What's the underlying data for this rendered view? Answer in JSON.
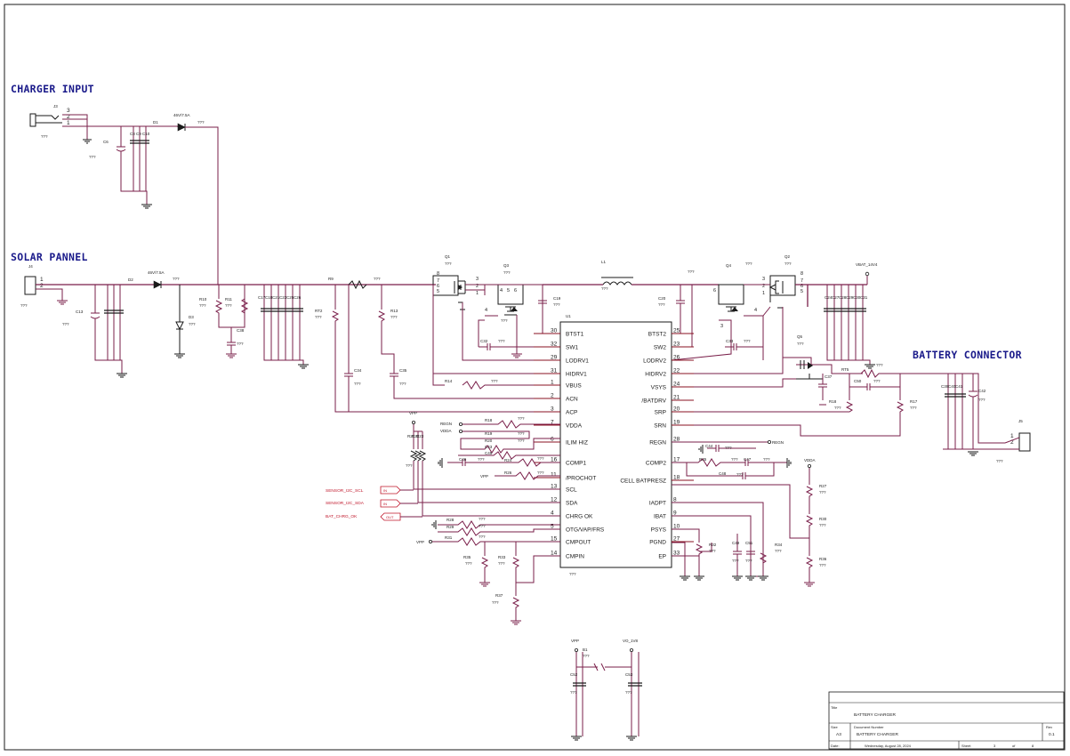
{
  "sections": {
    "charger_input": "CHARGER INPUT",
    "solar_panel": "SOLAR PANNEL",
    "battery_connector": "BATTERY CONNECTOR"
  },
  "ic": {
    "ref": "U1",
    "value": "???",
    "left_pins": [
      {
        "num": "30",
        "name": "BTST1"
      },
      {
        "num": "32",
        "name": "SW1"
      },
      {
        "num": "29",
        "name": "LODRV1"
      },
      {
        "num": "31",
        "name": "HIDRV1"
      },
      {
        "num": "1",
        "name": "VBUS"
      },
      {
        "num": "2",
        "name": "ACN"
      },
      {
        "num": "3",
        "name": "ACP"
      },
      {
        "num": "7",
        "name": "VDDA"
      },
      {
        "num": "6",
        "name": "ILIM_HIZ"
      },
      {
        "num": "16",
        "name": "COMP1"
      },
      {
        "num": "11",
        "name": "/PROCHOT"
      },
      {
        "num": "13",
        "name": "SCL"
      },
      {
        "num": "12",
        "name": "SDA"
      },
      {
        "num": "4",
        "name": "CHRG_OK"
      },
      {
        "num": "5",
        "name": "OTG/VAP/FRS"
      },
      {
        "num": "15",
        "name": "CMPOUT"
      },
      {
        "num": "14",
        "name": "CMPIN"
      }
    ],
    "right_pins": [
      {
        "num": "25",
        "name": "BTST2"
      },
      {
        "num": "23",
        "name": "SW2"
      },
      {
        "num": "26",
        "name": "LODRV2"
      },
      {
        "num": "22",
        "name": "HIDRV2"
      },
      {
        "num": "24",
        "name": "VSYS"
      },
      {
        "num": "21",
        "name": "/BATDRV"
      },
      {
        "num": "20",
        "name": "SRP"
      },
      {
        "num": "19",
        "name": "SRN"
      },
      {
        "num": "28",
        "name": "REGN"
      },
      {
        "num": "17",
        "name": "COMP2"
      },
      {
        "num": "18",
        "name": "CELL_BATPRESZ"
      },
      {
        "num": "8",
        "name": "IADPT"
      },
      {
        "num": "9",
        "name": "IBAT"
      },
      {
        "num": "10",
        "name": "PSYS"
      },
      {
        "num": "27",
        "name": "PGND"
      },
      {
        "num": "33",
        "name": "EP"
      }
    ]
  },
  "nets": {
    "vbat": "VBAT_14V4",
    "regn": "REGN",
    "vdda": "VDDA",
    "vpp": "VPP",
    "vo": "VO_1V8",
    "sensor_scl": "SENSOR_I2C_SCL",
    "sensor_sda": "SENSOR_I2C_SDA",
    "bat_chrg_ok": "BAT_CHRG_OK",
    "port_in": "IN",
    "port_out": "OUT"
  },
  "parts": {
    "j1": "J1",
    "j3": "J3",
    "j4": "J4",
    "j5": "J5",
    "d1": "D1",
    "d2": "D2",
    "d3": "D3",
    "diode_value": "46V/7.5A",
    "q1": "Q1",
    "q2": "Q2",
    "q3": "Q3",
    "q4": "Q4",
    "q5": "Q5",
    "l1": "L1",
    "b1": "B1",
    "r_labels": [
      "R9",
      "R10",
      "R11",
      "R12",
      "R13",
      "R14",
      "R15",
      "R16",
      "R17",
      "R18",
      "R19",
      "R20",
      "R21",
      "R22",
      "R23",
      "R24",
      "R25",
      "R26",
      "R27",
      "R28",
      "R29",
      "R30",
      "R31",
      "R32",
      "R33",
      "R34",
      "R35",
      "R36",
      "R37",
      "R38"
    ],
    "c_labels": [
      "C6",
      "C13",
      "C17",
      "C19",
      "C20",
      "C23",
      "C32",
      "C33",
      "C34",
      "C35",
      "C36",
      "C37",
      "C38",
      "C39",
      "C40",
      "C41",
      "C42",
      "C43",
      "C44",
      "C45",
      "C46",
      "C47",
      "C48",
      "C49",
      "C50",
      "C51",
      "C52",
      "C53"
    ],
    "placeholder": "???"
  },
  "title_block": {
    "title_label": "Title",
    "title": "BATTERY CHARGER",
    "size_label": "Size",
    "size": "A3",
    "docnum_label": "Document Number",
    "docnum": "BATTERY CHARGER",
    "rev_label": "Rev",
    "rev": "0.1",
    "date_label": "Date:",
    "date": "Wednesday, August 28, 2024",
    "sheet_label": "Sheet",
    "sheet": "3",
    "of_label": "of",
    "sheets": "8"
  },
  "colors": {
    "wire": "#7a1f4a",
    "pin": "#8a1020",
    "section_text": "#1a1a8a",
    "net_red": "#c0162a"
  }
}
